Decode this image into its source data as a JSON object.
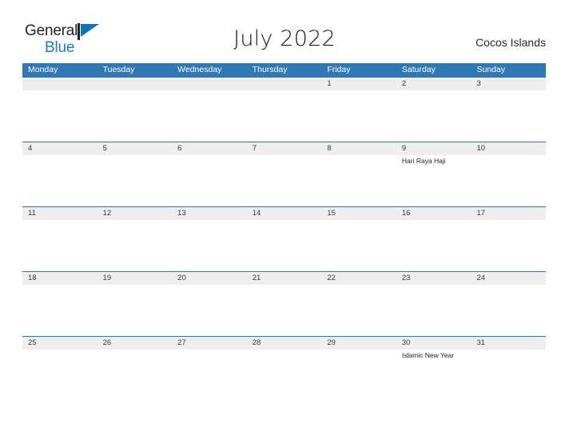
{
  "header": {
    "logo": {
      "text_primary": "General",
      "text_secondary": "Blue",
      "flag_icon": "flag-triangle-icon"
    },
    "title": "July 2022",
    "region": "Cocos Islands"
  },
  "colors": {
    "header_blue": "#3077b6",
    "date_band_gray": "#eeeeee",
    "logo_blue": "#1a7cc4",
    "text_dark": "#231f20"
  },
  "calendar": {
    "weekdays": [
      "Monday",
      "Tuesday",
      "Wednesday",
      "Thursday",
      "Friday",
      "Saturday",
      "Sunday"
    ],
    "weeks": [
      {
        "days": [
          {
            "date": "",
            "event": ""
          },
          {
            "date": "",
            "event": ""
          },
          {
            "date": "",
            "event": ""
          },
          {
            "date": "",
            "event": ""
          },
          {
            "date": "1",
            "event": ""
          },
          {
            "date": "2",
            "event": ""
          },
          {
            "date": "3",
            "event": ""
          }
        ]
      },
      {
        "days": [
          {
            "date": "4",
            "event": ""
          },
          {
            "date": "5",
            "event": ""
          },
          {
            "date": "6",
            "event": ""
          },
          {
            "date": "7",
            "event": ""
          },
          {
            "date": "8",
            "event": ""
          },
          {
            "date": "9",
            "event": "Hari Raya Haji"
          },
          {
            "date": "10",
            "event": ""
          }
        ]
      },
      {
        "days": [
          {
            "date": "11",
            "event": ""
          },
          {
            "date": "12",
            "event": ""
          },
          {
            "date": "13",
            "event": ""
          },
          {
            "date": "14",
            "event": ""
          },
          {
            "date": "15",
            "event": ""
          },
          {
            "date": "16",
            "event": ""
          },
          {
            "date": "17",
            "event": ""
          }
        ]
      },
      {
        "days": [
          {
            "date": "18",
            "event": ""
          },
          {
            "date": "19",
            "event": ""
          },
          {
            "date": "20",
            "event": ""
          },
          {
            "date": "21",
            "event": ""
          },
          {
            "date": "22",
            "event": ""
          },
          {
            "date": "23",
            "event": ""
          },
          {
            "date": "24",
            "event": ""
          }
        ]
      },
      {
        "days": [
          {
            "date": "25",
            "event": ""
          },
          {
            "date": "26",
            "event": ""
          },
          {
            "date": "27",
            "event": ""
          },
          {
            "date": "28",
            "event": ""
          },
          {
            "date": "29",
            "event": ""
          },
          {
            "date": "30",
            "event": "Islamic New Year"
          },
          {
            "date": "31",
            "event": ""
          }
        ]
      }
    ]
  }
}
